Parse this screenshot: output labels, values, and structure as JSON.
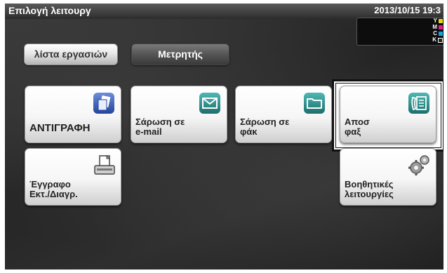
{
  "header": {
    "title": "Επιλογή λειτουργ",
    "datetime": "2013/10/15 19:3"
  },
  "toner": {
    "letters": [
      "Y",
      "M",
      "C",
      "K"
    ],
    "colors": [
      "#e6d51c",
      "#e0218a",
      "#18a0d8",
      "#111111"
    ]
  },
  "tabs": [
    {
      "label": "λίστα εργασιών",
      "active": false
    },
    {
      "label": "Μετρητής",
      "active": true
    }
  ],
  "tiles": {
    "copy": {
      "line1": "ΑΝΤΙΓΡΑΦΗ",
      "icon": "copy-icon"
    },
    "scan_email": {
      "line1": "Σάρωση σε",
      "line2": "e-mail",
      "icon": "envelope-icon"
    },
    "scan_folder": {
      "line1": "Σάρωση σε",
      "line2": "φάκ",
      "icon": "folder-icon"
    },
    "fax": {
      "line1": "Αποσ",
      "line2": "φαξ",
      "icon": "fax-icon",
      "selected": true
    },
    "user_box": {
      "line1": "Έγγραφο",
      "line2": "Εκτ./Διαγρ.",
      "icon": "printer-icon"
    },
    "utility": {
      "line1": "Βοηθητικές",
      "line2": "λειτουργίες",
      "icon": "gears-icon"
    }
  }
}
